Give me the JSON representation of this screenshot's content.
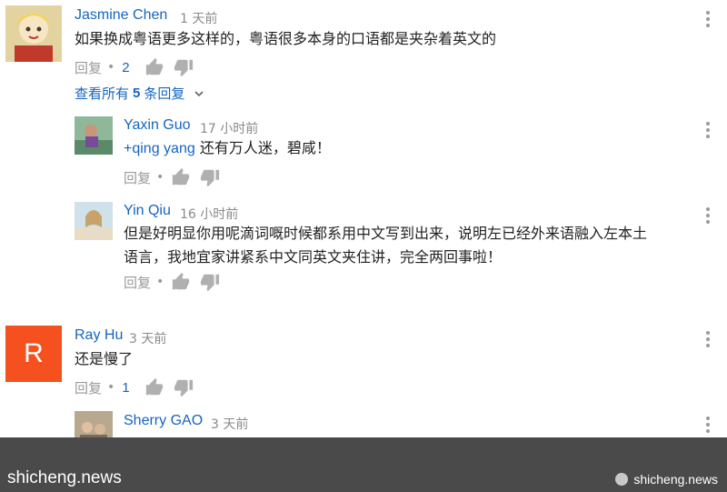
{
  "comments": [
    {
      "author": "Jasmine Chen",
      "time": "1 天前",
      "text": "如果换成粤语更多这样的，粤语很多本身的口语都是夹杂着英文的",
      "reply_label": "回复",
      "likes": "2",
      "view_replies": {
        "prefix": "查看所有",
        "count": "5",
        "suffix": "条回复"
      }
    },
    {
      "author": "Yaxin Guo",
      "time": "17 小时前",
      "mention": "+qing yang",
      "text": "还有万人迷，碧咸！",
      "reply_label": "回复"
    },
    {
      "author": "Yin Qiu",
      "time": "16 小时前",
      "text_line1": "但是好明显你用呢滴词嘅时候都系用中文写到出来，说明左已经外来语融入左本土",
      "text_line2": "语言，我地宜家讲紧系中文同英文夹住讲，完全两回事啦！",
      "reply_label": "回复"
    },
    {
      "author": "Ray Hu",
      "avatar_letter": "R",
      "avatar_color": "#f4511e",
      "time": "3 天前",
      "text": "还是慢了",
      "reply_label": "回复",
      "likes": "1"
    },
    {
      "author": "Sherry GAO",
      "time": "3 天前"
    }
  ],
  "watermark": {
    "left": "shicheng.news",
    "right": "shicheng.news"
  },
  "colors": {
    "link": "#1565c0",
    "footer_bg": "#4a4a4a"
  }
}
